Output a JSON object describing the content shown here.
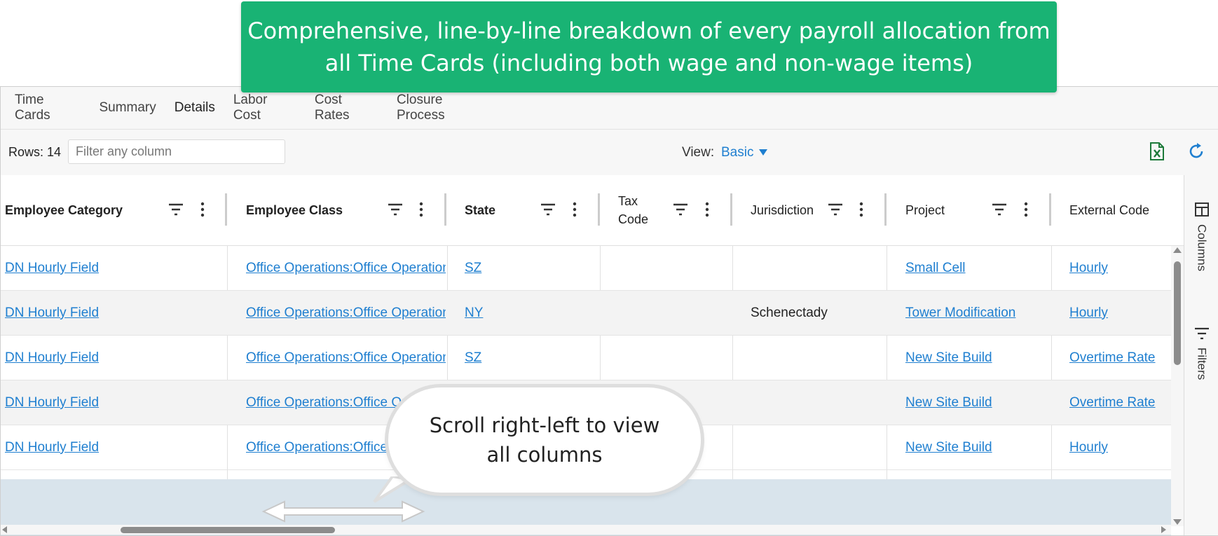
{
  "banner": {
    "line1": "Comprehensive, line-by-line breakdown of every payroll allocation from",
    "line2": "all Time Cards (including both wage and non-wage items)"
  },
  "tabs": [
    {
      "label": "Time Cards",
      "active": false
    },
    {
      "label": "Summary",
      "active": false
    },
    {
      "label": "Details",
      "active": true
    },
    {
      "label": "Labor Cost",
      "active": false
    },
    {
      "label": "Cost Rates",
      "active": false
    },
    {
      "label": "Closure Process",
      "active": false
    }
  ],
  "toolbar": {
    "rows_label": "Rows: 14",
    "filter_placeholder": "Filter any column",
    "view_label": "View:",
    "view_value": "Basic",
    "excel_icon": "excel-export-icon",
    "refresh_icon": "refresh-icon"
  },
  "columns": [
    {
      "label": "Employee Category"
    },
    {
      "label": "Employee Class"
    },
    {
      "label": "State"
    },
    {
      "label": "Tax Code"
    },
    {
      "label": "Jurisdiction"
    },
    {
      "label": "Project"
    },
    {
      "label": "External Code"
    }
  ],
  "rows": [
    {
      "category": "DN Hourly Field",
      "class": "Office Operations:Office Operation",
      "state": "SZ",
      "tax_code": "",
      "jurisdiction": "",
      "project": "Small Cell",
      "external_code": "Hourly"
    },
    {
      "category": "DN Hourly Field",
      "class": "Office Operations:Office Operation",
      "state": "NY",
      "tax_code": "",
      "jurisdiction": "Schenectady",
      "project": "Tower Modification",
      "external_code": "Hourly"
    },
    {
      "category": "DN Hourly Field",
      "class": "Office Operations:Office Operation",
      "state": "SZ",
      "tax_code": "",
      "jurisdiction": "",
      "project": "New Site Build",
      "external_code": "Overtime Rate"
    },
    {
      "category": "DN Hourly Field",
      "class": "Office Operations:Office Op",
      "state": "",
      "tax_code": "",
      "jurisdiction": "",
      "project": "New Site Build",
      "external_code": "Overtime Rate"
    },
    {
      "category": "DN Hourly Field",
      "class": "Office Operations:Office",
      "state": "",
      "tax_code": "",
      "jurisdiction": "",
      "project": "New Site Build",
      "external_code": "Hourly"
    }
  ],
  "side_panel": {
    "columns_label": "Columns",
    "filters_label": "Filters"
  },
  "callout": {
    "line1": "Scroll right-left to view",
    "line2": "all columns"
  },
  "colors": {
    "banner": "#19b374",
    "link": "#1f7fd0",
    "tab_active": "#2b8fd6",
    "selected_row": "#d9e4ec"
  }
}
